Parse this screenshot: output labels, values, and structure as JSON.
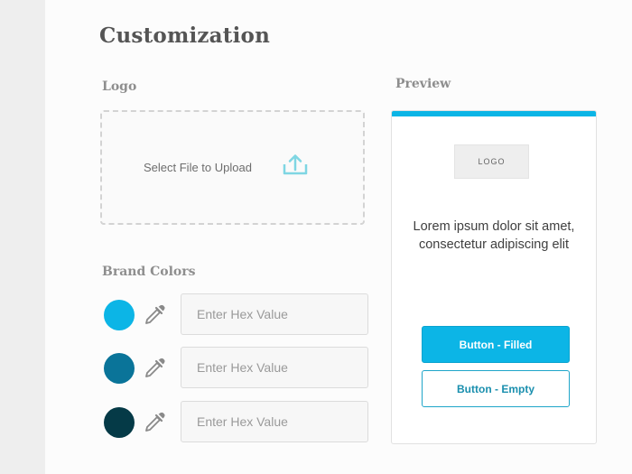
{
  "page": {
    "title": "Customization"
  },
  "logo": {
    "label": "Logo",
    "upload_text": "Select File to Upload",
    "upload_icon": "upload-icon"
  },
  "brand_colors": {
    "label": "Brand Colors",
    "rows": [
      {
        "swatch_color": "#0cb5e6",
        "placeholder": "Enter Hex Value",
        "value": ""
      },
      {
        "swatch_color": "#0a7499",
        "placeholder": "Enter Hex Value",
        "value": ""
      },
      {
        "swatch_color": "#053a47",
        "placeholder": "Enter Hex Value",
        "value": ""
      }
    ],
    "picker_icon": "eyedropper-icon"
  },
  "preview": {
    "label": "Preview",
    "accent_color": "#0cb5e6",
    "logo_text": "LOGO",
    "body_text": "Lorem ipsum dolor sit amet, consectetur adipiscing elit",
    "button_filled": "Button - Filled",
    "button_empty": "Button - Empty"
  }
}
